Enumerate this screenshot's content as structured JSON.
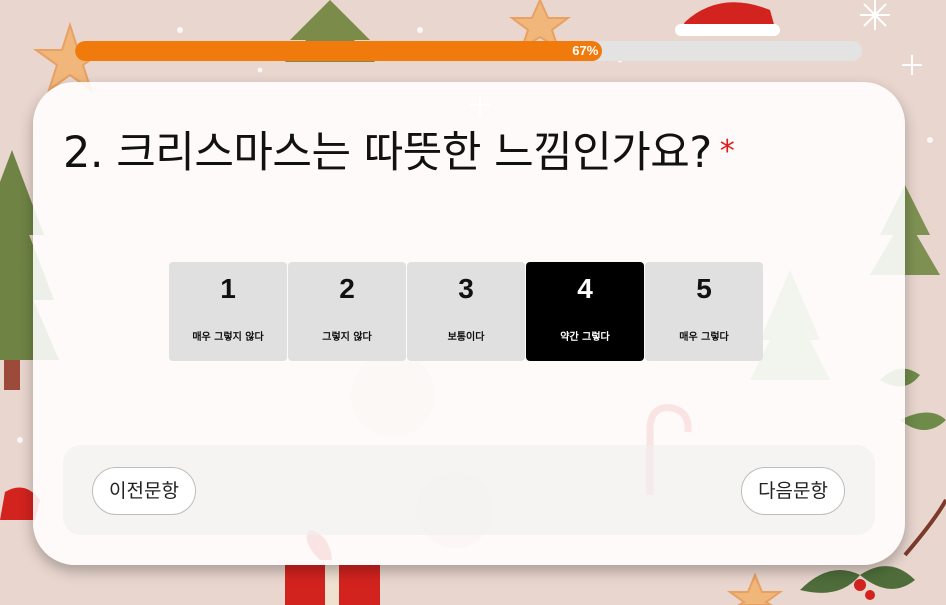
{
  "progress": {
    "percent": 67,
    "label": "67%"
  },
  "question": {
    "text": "2. 크리스마스는 따뜻한 느낌인가요?",
    "required_mark": "*"
  },
  "scale": {
    "selected": 4,
    "options": [
      {
        "value": "1",
        "label": "매우 그렇지 않다"
      },
      {
        "value": "2",
        "label": "그렇지 않다"
      },
      {
        "value": "3",
        "label": "보통이다"
      },
      {
        "value": "4",
        "label": "약간 그렇다"
      },
      {
        "value": "5",
        "label": "매우 그렇다"
      }
    ]
  },
  "nav": {
    "prev_label": "이전문항",
    "next_label": "다음문항"
  },
  "colors": {
    "accent": "#f07a0c",
    "selected_bg": "#000000",
    "option_bg": "#e0e0e0",
    "required": "#e01b1b"
  },
  "background": {
    "theme": "christmas pattern (trees, stars, ornaments, santa hat, gift, candy cane, snowflakes)"
  }
}
